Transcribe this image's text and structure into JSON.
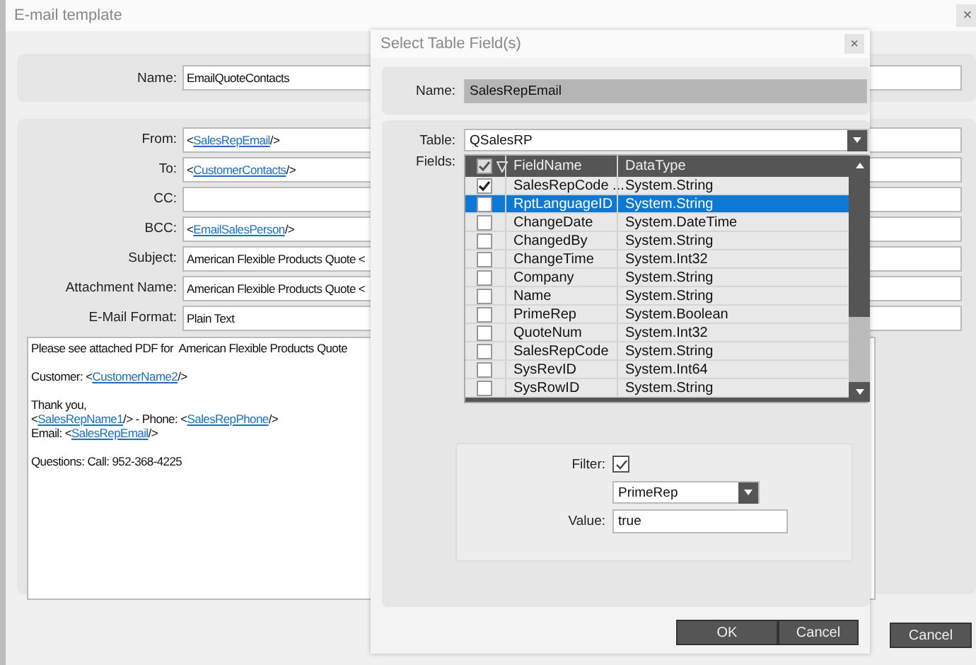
{
  "window": {
    "title": "E-mail template",
    "close": "×"
  },
  "name_field": {
    "label": "Name:",
    "value": "EmailQuoteContacts"
  },
  "fields": [
    {
      "label": "From:",
      "parts": [
        {
          "text": "<"
        },
        {
          "link": "SalesRepEmail"
        },
        {
          "text": "/>"
        }
      ]
    },
    {
      "label": "To:",
      "parts": [
        {
          "text": "<"
        },
        {
          "link": "CustomerContacts"
        },
        {
          "text": "/>"
        }
      ]
    },
    {
      "label": "CC:"
    },
    {
      "label": "BCC:",
      "parts": [
        {
          "text": "<"
        },
        {
          "link": "EmailSalesPerson"
        },
        {
          "text": "/>"
        }
      ]
    },
    {
      "label": "Subject:",
      "parts": [
        {
          "text": "American Flexible Products Quote <"
        }
      ]
    },
    {
      "label": "Attachment Name:",
      "parts": [
        {
          "text": "American Flexible Products Quote <"
        }
      ]
    },
    {
      "label": "E-Mail Format:",
      "parts": [
        {
          "text": "Plain Text"
        }
      ]
    }
  ],
  "body_paragraphs": [
    [
      [
        {
          "text": "Please see attached PDF for  American Flexible Products Quote"
        }
      ]
    ],
    [
      [
        {
          "text": "Customer: <"
        },
        {
          "link": "CustomerName2"
        },
        {
          "text": "/>"
        }
      ]
    ],
    [
      [
        {
          "text": "Thank you,"
        }
      ],
      [
        {
          "text": "<"
        },
        {
          "link": "SalesRepName1"
        },
        {
          "text": "/> - Phone: <"
        },
        {
          "link": "SalesRepPhone"
        },
        {
          "text": "/>"
        }
      ],
      [
        {
          "text": "Email: <"
        },
        {
          "link": "SalesRepEmail"
        },
        {
          "text": "/>"
        }
      ]
    ],
    [
      [
        {
          "text": "Questions: Call: 952-368-4225"
        }
      ]
    ]
  ],
  "cancel_button": "Cancel",
  "dialog": {
    "title": "Select Table Field(s)",
    "close": "×",
    "name": {
      "label": "Name:",
      "value": "SalesRepEmail"
    },
    "table": {
      "label": "Table:",
      "value": "QSalesRP"
    },
    "fields_label": "Fields:",
    "grid": {
      "header_checked": true,
      "columns": [
        "FieldName",
        "DataType"
      ],
      "rows": [
        {
          "checked": true,
          "selected": false,
          "name": "SalesRepCode ...",
          "type": "System.String"
        },
        {
          "checked": false,
          "selected": true,
          "name": "RptLanguageID",
          "type": "System.String"
        },
        {
          "checked": false,
          "selected": false,
          "name": "ChangeDate",
          "type": "System.DateTime"
        },
        {
          "checked": false,
          "selected": false,
          "name": "ChangedBy",
          "type": "System.String"
        },
        {
          "checked": false,
          "selected": false,
          "name": "ChangeTime",
          "type": "System.Int32"
        },
        {
          "checked": false,
          "selected": false,
          "name": "Company",
          "type": "System.String"
        },
        {
          "checked": false,
          "selected": false,
          "name": "Name",
          "type": "System.String"
        },
        {
          "checked": false,
          "selected": false,
          "name": "PrimeRep",
          "type": "System.Boolean"
        },
        {
          "checked": false,
          "selected": false,
          "name": "QuoteNum",
          "type": "System.Int32"
        },
        {
          "checked": false,
          "selected": false,
          "name": "SalesRepCode",
          "type": "System.String"
        },
        {
          "checked": false,
          "selected": false,
          "name": "SysRevID",
          "type": "System.Int64"
        },
        {
          "checked": false,
          "selected": false,
          "name": "SysRowID",
          "type": "System.String"
        }
      ]
    },
    "filter": {
      "label": "Filter:",
      "checked": true,
      "field": "PrimeRep",
      "value_label": "Value:",
      "value": "true"
    },
    "buttons": [
      "OK",
      "Cancel"
    ]
  }
}
